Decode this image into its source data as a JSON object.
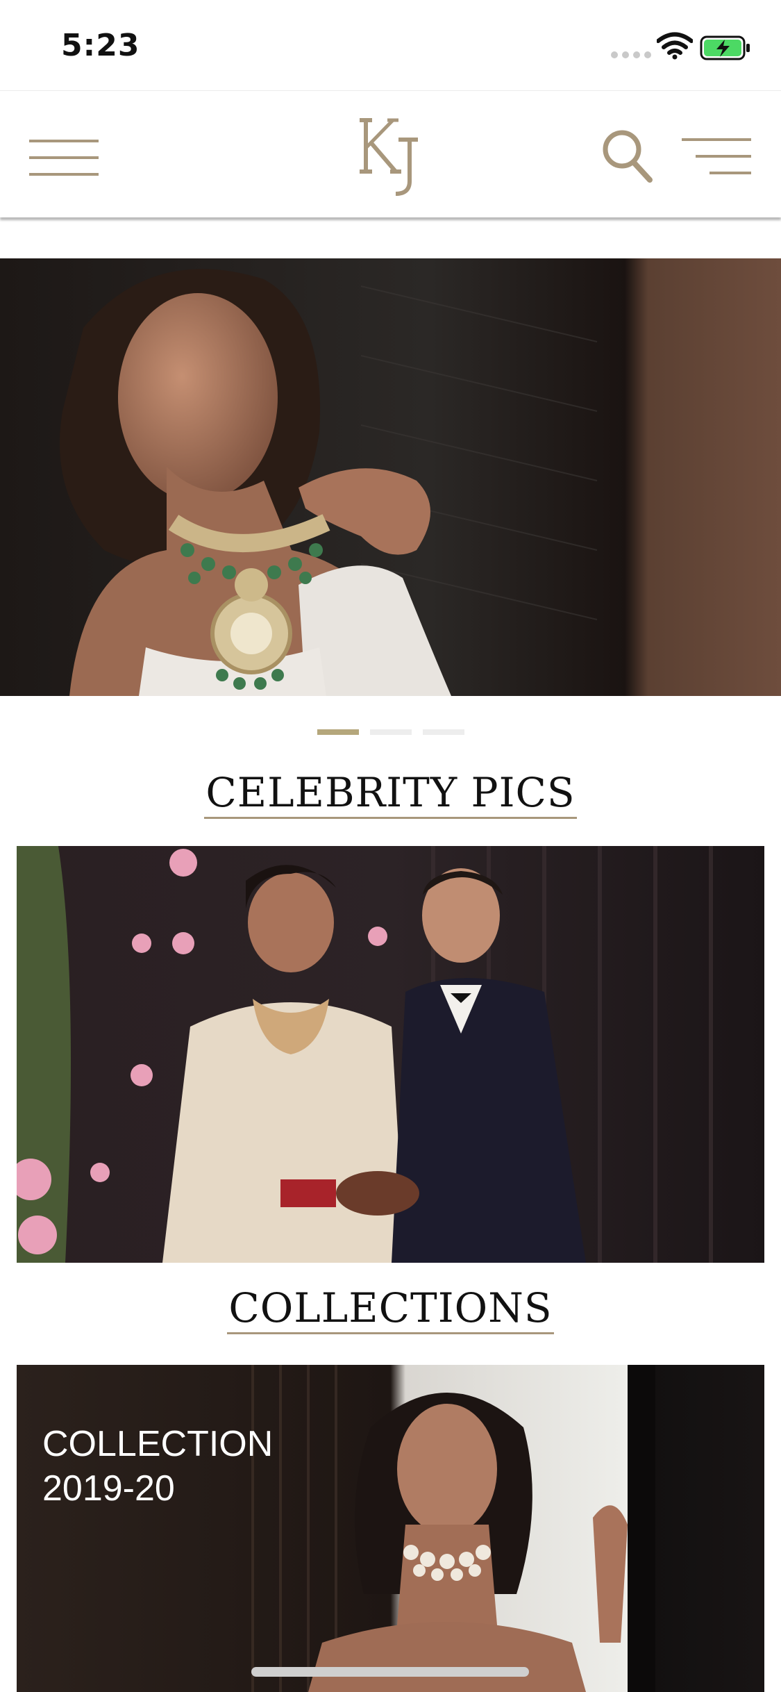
{
  "status_bar": {
    "time": "5:23"
  },
  "header": {
    "logo_text": "KJ",
    "menu_icon": "hamburger-menu-icon",
    "search_icon": "search-icon",
    "filter_icon": "filter-menu-icon",
    "accent_color": "#a8977c"
  },
  "hero": {
    "image": "woman-wearing-green-kundan-choker-necklace",
    "carousel": {
      "count": 3,
      "active_index": 0
    }
  },
  "sections": {
    "celebrity": {
      "heading": "CELEBRITY PICS",
      "image": "celebrity-couple-in-bridal-lehenga-and-velvet-tuxedo"
    },
    "collections": {
      "heading": "COLLECTIONS",
      "card_title": "COLLECTION 2019-20",
      "image": "woman-wearing-pearl-choker"
    }
  }
}
